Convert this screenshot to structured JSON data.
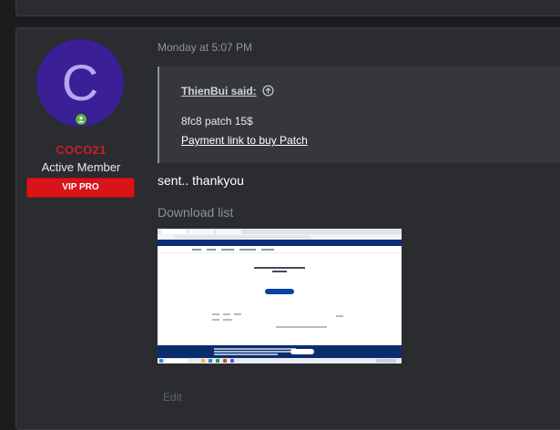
{
  "post": {
    "author": {
      "avatar_letter": "C",
      "avatar_color": "#3a1f96",
      "username": "COCO21",
      "username_color": "#c9202a",
      "title": "Active Member",
      "banner": "VIP PRO",
      "banner_color": "#d8141a",
      "status_icon": "online-user-icon"
    },
    "timestamp": "Monday at 5:07 PM",
    "quote": {
      "author": "ThienBui said:",
      "author_icon": "arrow-up-circle-icon",
      "line1": "8fc8 patch 15$",
      "link": "Payment link to buy Patch"
    },
    "message": "sent.. thankyou",
    "attachments": {
      "heading": "Download list",
      "image_description": "screenshot-thumbnail"
    },
    "actions": {
      "edit": "Edit"
    }
  }
}
